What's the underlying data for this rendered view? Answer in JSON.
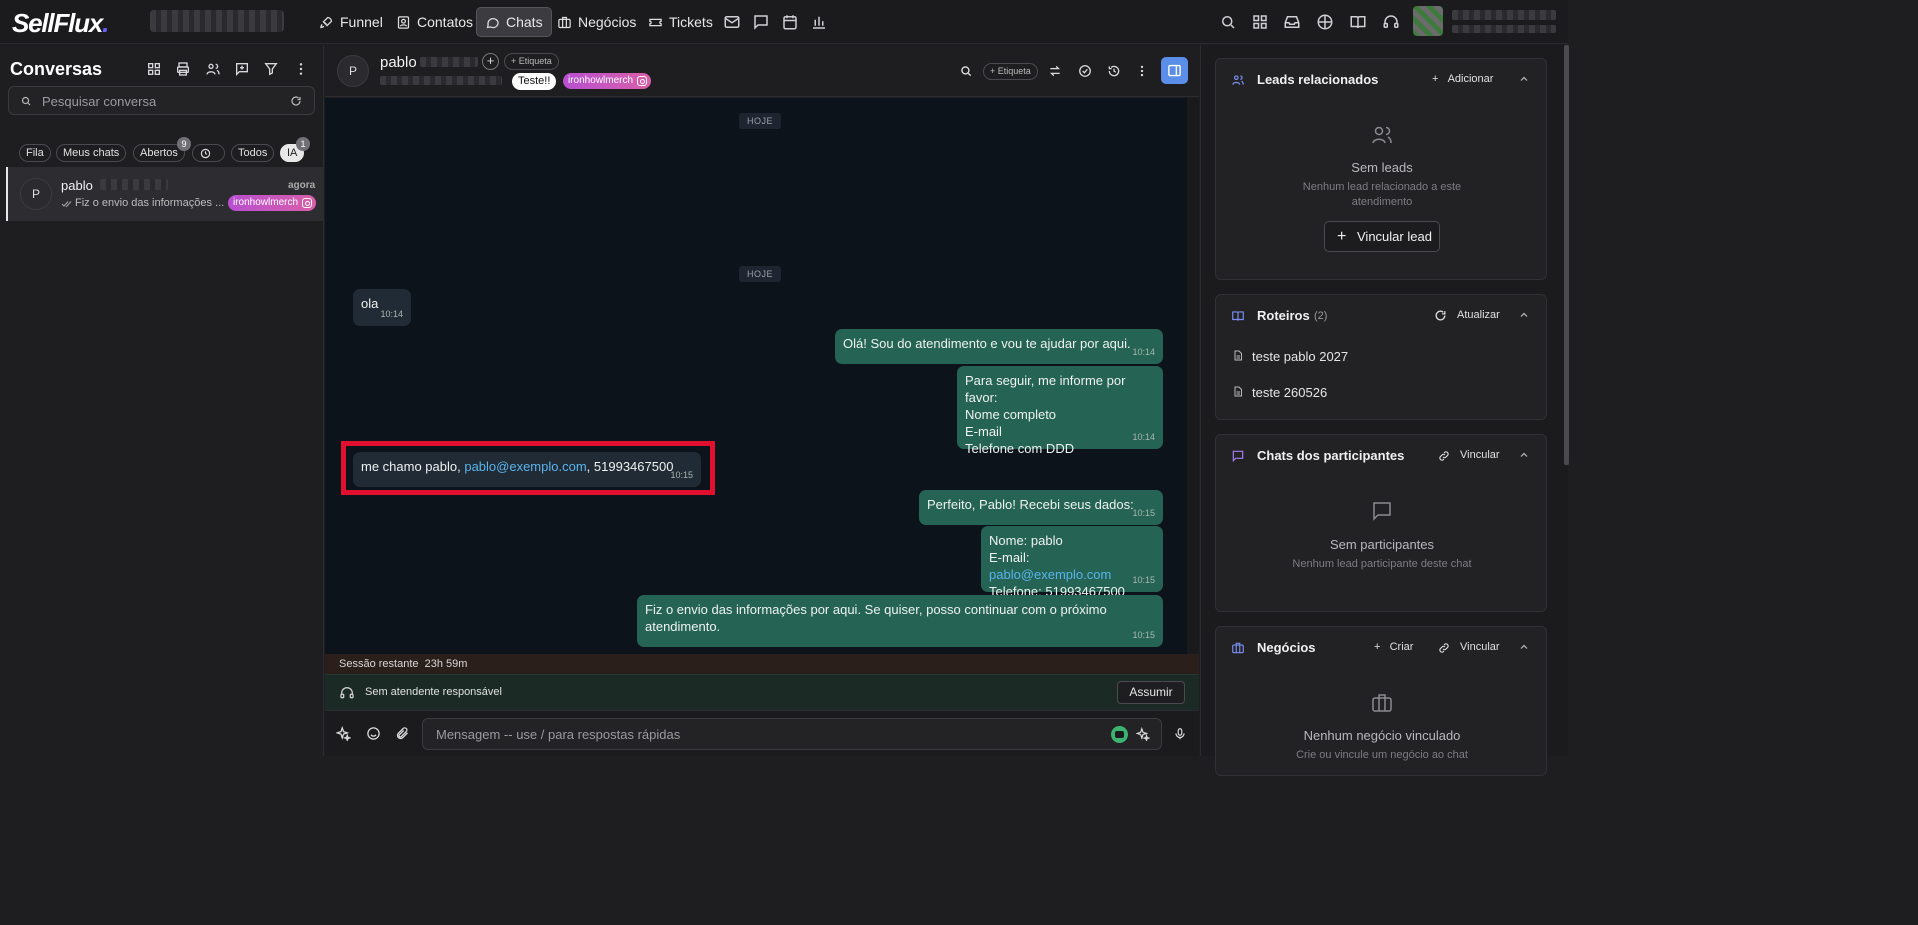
{
  "app": {
    "logo_text": "SellFlux",
    "logo_dot": "."
  },
  "nav": [
    {
      "id": "funnel",
      "label": "Funnel",
      "icon": "rocket-icon"
    },
    {
      "id": "contatos",
      "label": "Contatos",
      "icon": "contacts-icon"
    },
    {
      "id": "chats",
      "label": "Chats",
      "icon": "chat-bubble-icon",
      "active": true
    },
    {
      "id": "negocios",
      "label": "Negócios",
      "icon": "briefcase-icon"
    },
    {
      "id": "tickets",
      "label": "Tickets",
      "icon": "ticket-icon"
    }
  ],
  "left": {
    "title": "Conversas",
    "search_placeholder": "Pesquisar conversa",
    "filters": [
      {
        "label": "Fila"
      },
      {
        "label": "Meus chats"
      },
      {
        "label": "Abertos",
        "count": "9"
      },
      {
        "label": ""
      },
      {
        "label": "Todos"
      },
      {
        "label": "IA",
        "count": "1"
      }
    ],
    "conversation": {
      "avatar": "P",
      "name": "pablo",
      "time": "agora",
      "preview": "Fiz o envio das informações ...",
      "tag": "ironhowlmerch"
    }
  },
  "chat": {
    "avatar": "P",
    "name": "pablo",
    "add_tag": "+ Etiqueta",
    "tags": [
      "Teste!!"
    ],
    "channel_tag": "ironhowlmerch",
    "day_label": "HOJE",
    "messages": [
      {
        "dir": "in",
        "lines": [
          "ola"
        ],
        "time": "10:14"
      },
      {
        "dir": "out",
        "lines": [
          "Olá! Sou do atendimento e vou te ajudar por aqui."
        ],
        "time": "10:14"
      },
      {
        "dir": "out",
        "lines": [
          "Para seguir, me informe por favor:",
          "Nome completo",
          "E-mail",
          "Telefone com DDD"
        ],
        "time": "10:14"
      },
      {
        "dir": "in",
        "prefix": "me chamo pablo, ",
        "link": "pablo@exemplo.com",
        "suffix": ", 51993467500",
        "time": "10:15"
      },
      {
        "dir": "out",
        "lines": [
          "Perfeito, Pablo! Recebi seus dados:"
        ],
        "time": "10:15"
      },
      {
        "dir": "out",
        "l1": "Nome: pablo",
        "l2_prefix": "E-mail: ",
        "l2_link": "pablo@exemplo.com",
        "l3": "Telefone: 51993467500",
        "time": "10:15"
      },
      {
        "dir": "out",
        "lines": [
          "Fiz o envio das informações por aqui. Se quiser, posso continuar com o próximo",
          "atendimento."
        ],
        "time": "10:15"
      }
    ],
    "session_label": "Sessão restante",
    "session_value": "23h 59m",
    "no_agent": "Sem atendente responsável",
    "assume_button": "Assumir",
    "composer_placeholder": "Mensagem -- use / para respostas rápidas"
  },
  "right": {
    "leads": {
      "title": "Leads relacionados",
      "action": "Adicionar",
      "empty_title": "Sem leads",
      "empty_sub": "Nenhum lead relacionado a este atendimento",
      "button": "Vincular lead"
    },
    "roteiros": {
      "title": "Roteiros",
      "count": "(2)",
      "action": "Atualizar",
      "items": [
        "teste pablo 2027",
        "teste 260526"
      ]
    },
    "participantes": {
      "title": "Chats dos participantes",
      "action": "Vincular",
      "empty_title": "Sem participantes",
      "empty_sub": "Nenhum lead participante deste chat"
    },
    "negocios": {
      "title": "Negócios",
      "action_create": "Criar",
      "action_link": "Vincular",
      "empty_title": "Nenhum negócio vinculado",
      "empty_sub": "Crie ou vincule um negócio ao chat"
    }
  },
  "colors": {
    "highlight_box": "#e0102e",
    "outgoing_bubble": "#256354",
    "incoming_bubble": "#212b35",
    "accent_blue": "#5b8ee8"
  }
}
